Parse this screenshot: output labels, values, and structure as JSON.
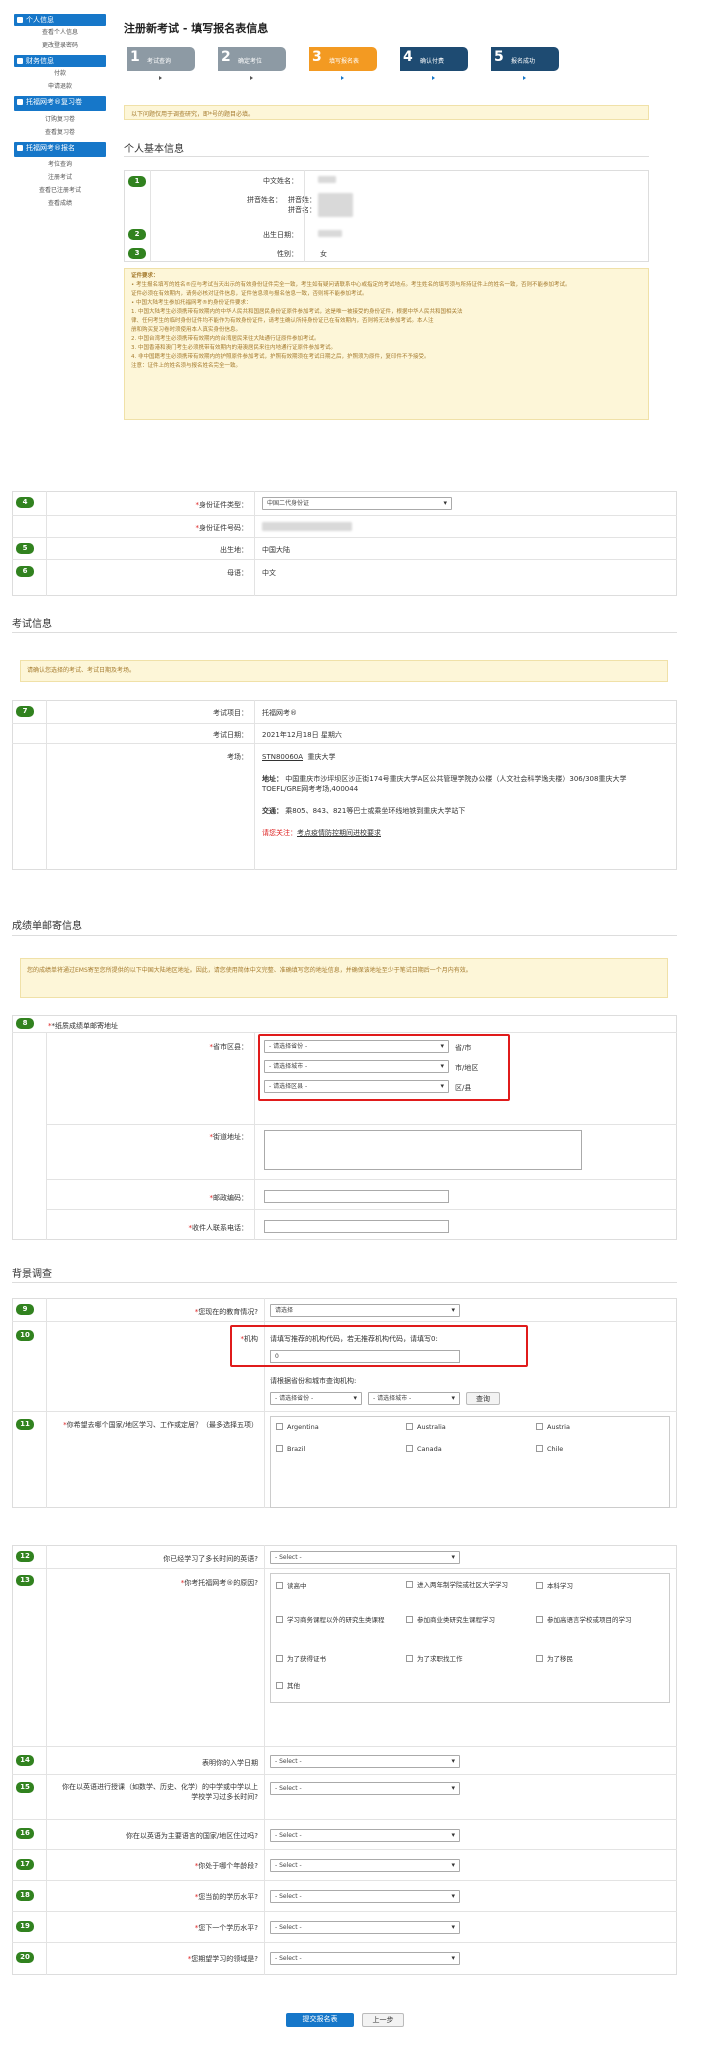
{
  "sidebar": {
    "personal": "个人信息",
    "view_personal": "查看个人信息",
    "change_password": "更改登录密码",
    "finance": "财务信息",
    "payment": "付款",
    "refund": "申请退款",
    "practice": "托福网考®复习卷",
    "order_practice": "订购复习卷",
    "view_practice": "查看复习卷",
    "register": "托福网考®报名",
    "exam_query": "考位查询",
    "register_exam": "注册考试",
    "view_registered": "查看已注册考试",
    "view_scores": "查看成绩"
  },
  "header": {
    "title": "注册新考试 - 填写报名表信息",
    "steps": [
      {
        "n": "1",
        "label": "考试查询"
      },
      {
        "n": "2",
        "label": "确定考位"
      },
      {
        "n": "3",
        "label": "填写报名表"
      },
      {
        "n": "4",
        "label": "确认付费"
      },
      {
        "n": "5",
        "label": "报名成功"
      }
    ]
  },
  "notice_top": "以下问题仅用于调查研究，即*号的题目必填。",
  "personal": {
    "title": "个人基本信息",
    "cn_name": "中文姓名：",
    "pinyin_name": "拼音姓名：",
    "pinyin_last": "拼音姓：",
    "pinyin_first": "拼音名：",
    "dob": "出生日期：",
    "gender": "性别：",
    "gender_val": "女",
    "req_title": "证件要求：",
    "req_lines": [
      "• 考生报名填写的姓名®应与考试当天出示的有效身份证件完全一致，考生如有疑问请联系中心或指定的考试地点。考生姓名的填写须与所持证件上的姓名一致，否则不能参加考试。",
      "  证件必须在有效期内，请务必核对证件信息，证件信息须与报名信息一致，否则将不能参加考试。",
      "• 中国大陆考生参加托福网考®的身份证件要求：",
      "  1. 中国大陆考生必须携带有效期内的中华人民共和国居民身份证原件参加考试，这是唯一被接受的身份证件，根据中华人民共和国相关法",
      "  律、任何考生的临时身份证件均不能作为有效身份证件，请考生确认所持身份证已在有效期内，否则将无法参加考试。本人注",
      "  册和购买复习卷时须使用本人真实身份信息。",
      "  2. 中国台湾考生必须携带有效期内的台湾居民来往大陆通行证原件参加考试。",
      "  3. 中国香港和澳门考生必须携带有效期内的港澳居民来往内地通行证原件参加考试。",
      "  4. 非中国籍考生必须携带有效期内的护照原件参加考试，护照有效期须在考试日期之后，护照须为原件，复印件不予接受。",
      "  注意：证件上的姓名须与报名姓名完全一致。"
    ]
  },
  "id": {
    "type_label": "身份证件类型：",
    "type_val": "中国二代身份证",
    "number_label": "身份证件号码：",
    "birthplace_label": "出生地：",
    "birthplace_val": "中国大陆",
    "native_label": "母语：",
    "native_val": "中文"
  },
  "exam": {
    "title": "考试信息",
    "notice": "请确认您选择的考试、考试日期及考场。",
    "item_label": "考试项目：",
    "item_val": "托福网考®",
    "date_label": "考试日期：",
    "date_val": "2021年12月18日 星期六",
    "center_label": "考场：",
    "center_code": "STN80060A",
    "center_name": "重庆大学",
    "addr_label": "地址：",
    "addr_val": "中国重庆市沙坪坝区沙正街174号重庆大学A区公共管理学院办公楼（人文社会科学逸夫楼）306/308重庆大学TOEFL/GRE网考考场,400044",
    "traffic_label": "交通：",
    "traffic_val": "乘805、843、821等巴士或乘坐环线地铁到重庆大学站下",
    "note_label": "请您关注：",
    "note_link": "考点疫情防控期间进校要求"
  },
  "mail": {
    "title": "成绩单邮寄信息",
    "notice": "您的成绩单将通过EMS寄至您所提供的以下中国大陆地区地址。因此，请您使用简体中文完整、准确填写您的地址信息，并确保该地址至少于笔试日期后一个月内有效。",
    "paper_label": "*纸质成绩单邮寄地址",
    "region_label": "省市区县：",
    "province_sel": "- 请选择省份 -",
    "city_sel": "- 请选择城市 -",
    "district_sel": "- 请选择区县 -",
    "province_unit": "省/市",
    "city_unit": "市/地区",
    "district_unit": "区/县",
    "street_label": "街道地址：",
    "zip_label": "邮政编码：",
    "phone_label": "收件人联系电话："
  },
  "bg": {
    "title": "背景调查",
    "q9": "您现在的教育情况?",
    "q9_sel": "请选择",
    "q10": "机构",
    "q10_hint": "请填写推荐的机构代码，若无推荐机构代码，请填写0:",
    "q10_val": "0",
    "q10_query_hint": "请根据省份和城市查询机构:",
    "q10_prov": "- 请选择省份 -",
    "q10_city": "- 请选择城市 -",
    "q10_btn": "查询",
    "q11": "你希望去哪个国家/地区学习、工作或定居？（最多选择五项）",
    "countries": [
      "Argentina",
      "Australia",
      "Austria",
      "Brazil",
      "Canada",
      "Chile"
    ],
    "q12": "你已经学习了多长时间的英语?",
    "select": "- Select -",
    "q13": "你考托福网考®的原因?",
    "reasons": [
      "读高中",
      "进入两年制学院或社区大学学习",
      "本科学习",
      "学习商务课程以外的研究生类课程",
      "参加商业类研究生课程学习",
      "参加高语言学校或项目的学习",
      "为了获得证书",
      "为了求职找工作",
      "为了移民",
      "其他"
    ],
    "q14": "表明你的入学日期",
    "q15": "你在以英语进行授课（如数学、历史、化学）的中学或中学以上学校学习过多长时间?",
    "q16": "你在以英语为主要语言的国家/地区住过吗?",
    "q17": "你处于哪个年龄段?",
    "q18": "您当前的学历水平?",
    "q19": "您下一个学历水平?",
    "q20": "您期望学习的领域是?"
  },
  "actions": {
    "submit": "提交报名表",
    "back": "上一步"
  }
}
